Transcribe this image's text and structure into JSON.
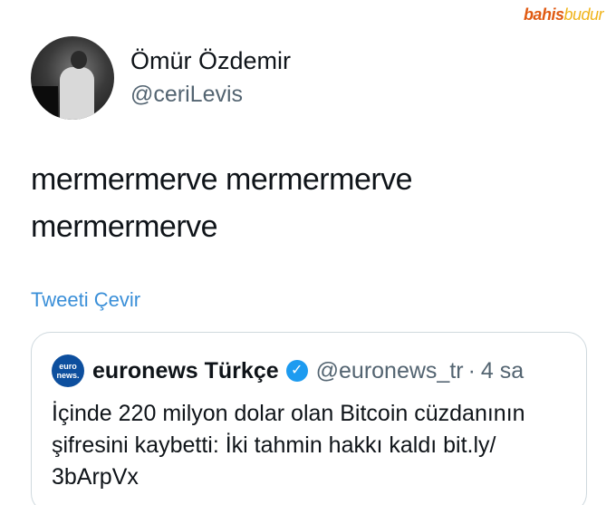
{
  "watermark": {
    "part1": "bahis",
    "part2": "budur"
  },
  "tweet": {
    "display_name": "Ömür Özdemir",
    "handle": "@ceriLevis",
    "text_line1": "mermermerve mermermerve",
    "text_line2": "mermermerve",
    "translate_label": "Tweeti Çevir"
  },
  "quoted": {
    "logo_top": "euro",
    "logo_bottom": "news.",
    "name": "euronews Türkçe",
    "verified_icon": "verified-badge-icon",
    "handle": "@euronews_tr",
    "separator": "·",
    "time": "4 sa",
    "text_line1": "İçinde 220 milyon dolar olan Bitcoin cüzdanının",
    "text_line2": "şifresini kaybetti: İki tahmin hakkı kaldı  bit.ly/",
    "text_line3": "3bArpVx"
  },
  "colors": {
    "link": "#3a8fd8",
    "secondary_text": "#536471",
    "verified": "#1d9bf0",
    "euronews_logo": "#0d4f9e"
  }
}
